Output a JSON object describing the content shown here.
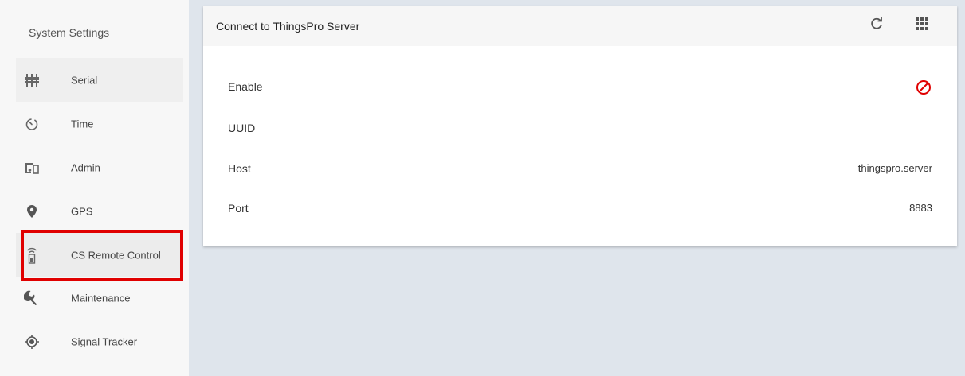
{
  "sidebar": {
    "header": "System Settings",
    "items": [
      {
        "label": "Serial",
        "icon": "serial-ports-icon"
      },
      {
        "label": "Time",
        "icon": "timer-icon"
      },
      {
        "label": "Admin",
        "icon": "devices-icon"
      },
      {
        "label": "GPS",
        "icon": "location-pin-icon"
      },
      {
        "label": "CS Remote Control",
        "icon": "remote-control-icon"
      },
      {
        "label": "Maintenance",
        "icon": "wrench-icon"
      },
      {
        "label": "Signal Tracker",
        "icon": "target-icon"
      }
    ],
    "active_index": 4
  },
  "card": {
    "title": "Connect to ThingsPro Server",
    "actions": [
      "refresh-icon",
      "grid-menu-icon"
    ],
    "rows": [
      {
        "label": "Enable",
        "value": "",
        "status_icon": "disabled-circle-icon"
      },
      {
        "label": "UUID",
        "value": ""
      },
      {
        "label": "Host",
        "value": "thingspro.server"
      },
      {
        "label": "Port",
        "value": "8883"
      }
    ]
  },
  "colors": {
    "highlight": "#e00000",
    "disabled_icon": "#e00000",
    "content_background": "#dfe5ec"
  }
}
